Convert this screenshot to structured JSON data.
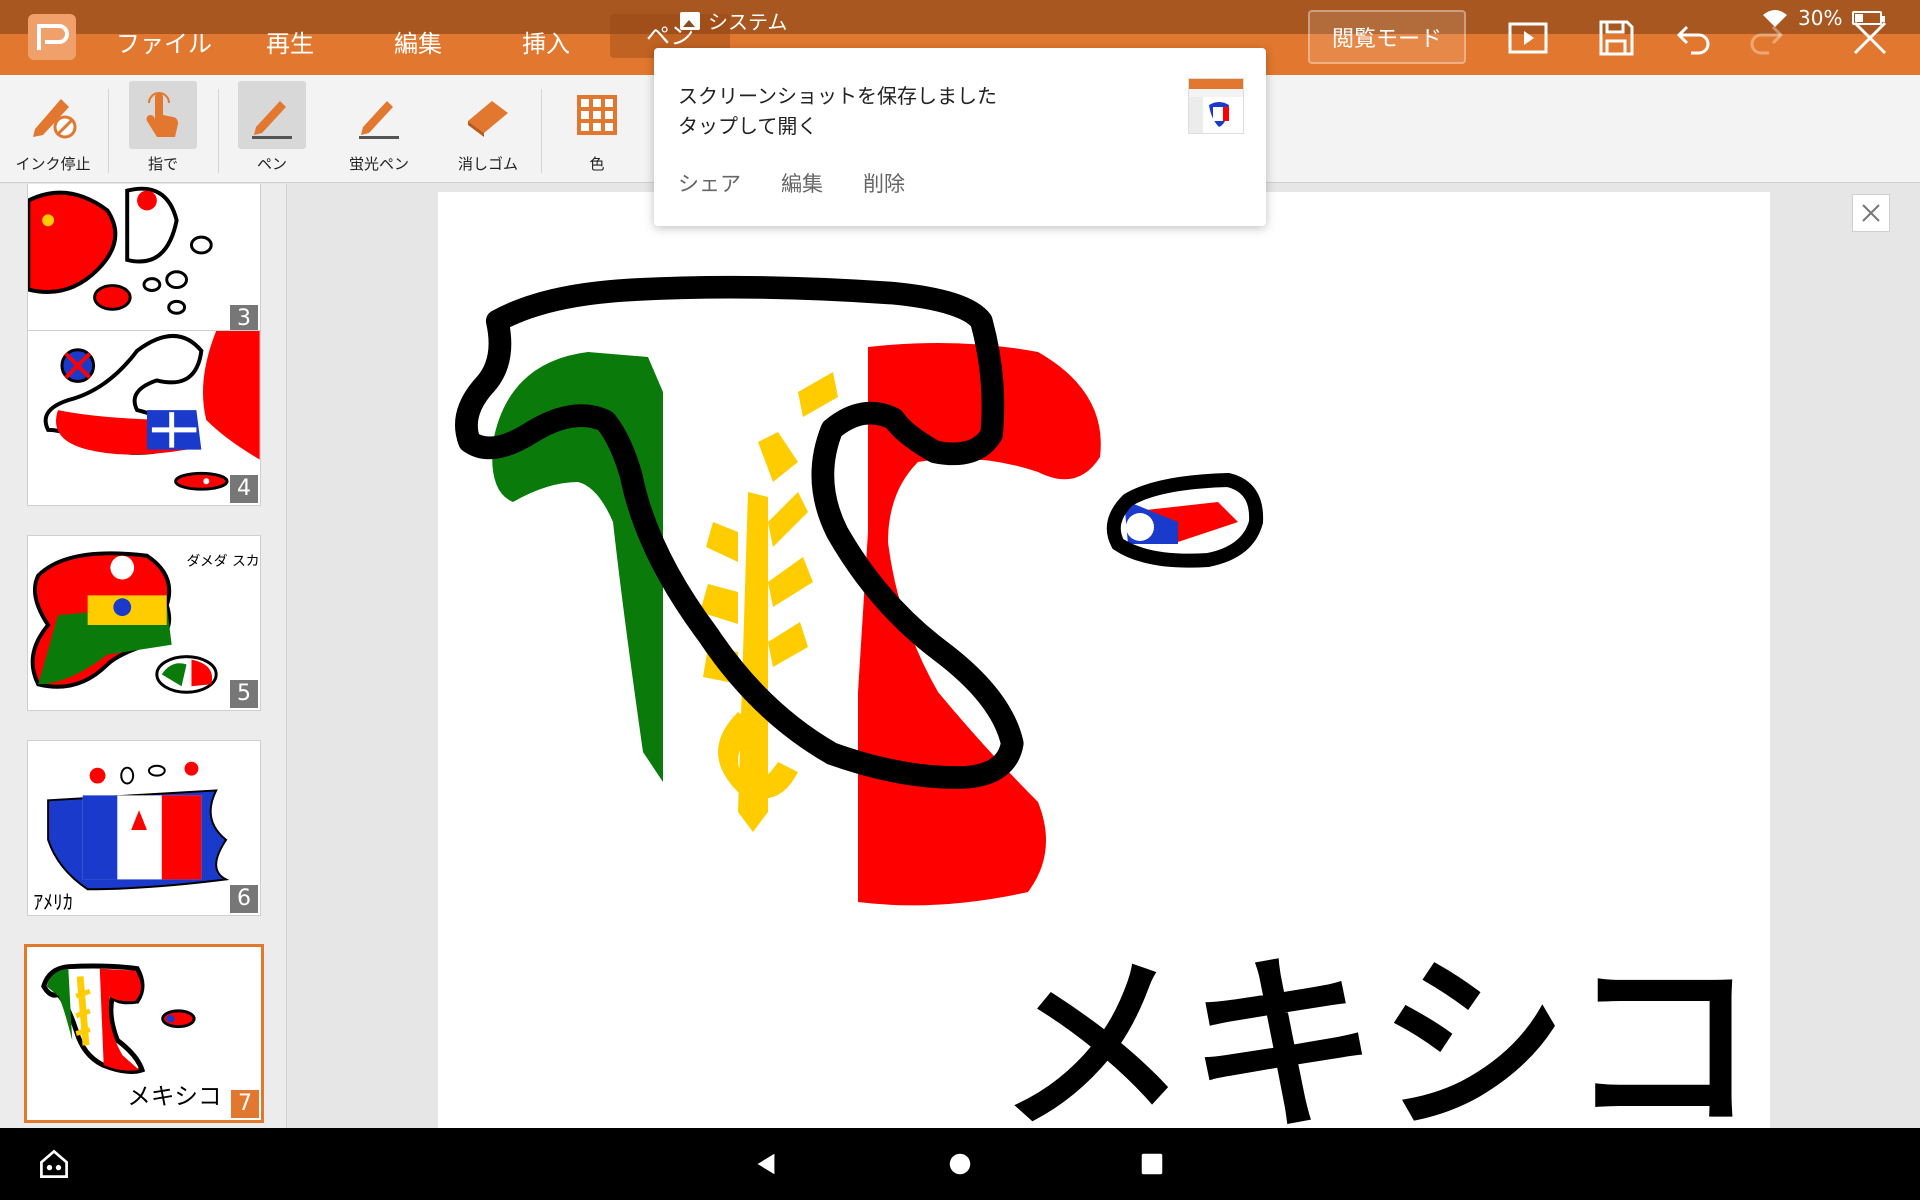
{
  "app": {
    "menu": [
      "ファイル",
      "再生",
      "編集",
      "挿入",
      "ペン"
    ],
    "reading_mode": "閲覧モード"
  },
  "status_bar": {
    "notification_source": "システム",
    "battery": "30%"
  },
  "ribbon": {
    "tools": [
      {
        "label": "インク停止",
        "icon": "ink-stop-icon"
      },
      {
        "label": "指で",
        "icon": "finger-icon"
      },
      {
        "label": "ペン",
        "icon": "pen-icon"
      },
      {
        "label": "蛍光ペン",
        "icon": "highlighter-icon"
      },
      {
        "label": "消しゴム",
        "icon": "eraser-icon"
      },
      {
        "label": "色",
        "icon": "color-grid-icon"
      }
    ]
  },
  "notification": {
    "title": "スクリーンショットを保存しました",
    "subtitle": "タップして開く",
    "actions": [
      "シェア",
      "編集",
      "削除"
    ]
  },
  "slides": {
    "numbers": [
      "3",
      "4",
      "5",
      "6",
      "7"
    ],
    "thumb5_text": "ダメダ スカル",
    "thumb6_text": "ｱﾒﾘｶ",
    "selected": "7"
  },
  "slide_text": "メキシコ",
  "colors": {
    "accent": "#e2782f",
    "green": "#0a7a0a",
    "red": "#ff0000",
    "gold": "#ffcc00",
    "blue": "#1a3acc"
  }
}
